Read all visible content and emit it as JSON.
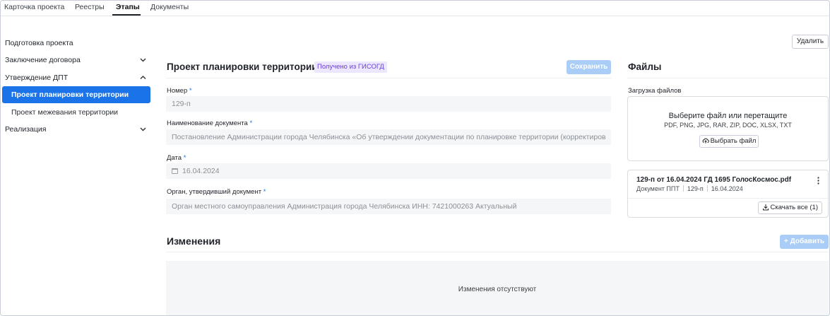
{
  "tabs": [
    {
      "label": "Карточка проекта",
      "active": false
    },
    {
      "label": "Реестры",
      "active": false
    },
    {
      "label": "Этапы",
      "active": true
    },
    {
      "label": "Документы",
      "active": false
    }
  ],
  "sidebar": {
    "items": [
      {
        "label": "Подготовка проекта"
      },
      {
        "label": "Заключение договора",
        "chevron": "chevron-down-icon"
      },
      {
        "label": "Утверждение ДПТ",
        "chevron": "chevron-up-icon"
      },
      {
        "label": "Проект планировки территории",
        "active": true
      },
      {
        "label": "Проект межевания территории"
      },
      {
        "label": "Реализация",
        "chevron": "chevron-down-icon"
      }
    ]
  },
  "form": {
    "title": "Проект планировки территории",
    "badge": "Получено из ГИСОГД",
    "save_label": "Сохранить",
    "fields": {
      "number": {
        "label": "Номер",
        "value": "129-п"
      },
      "doc_name": {
        "label": "Наименование документа",
        "value": "Постановление Администрации города Челябинска «Об утверждении  документации по планировке территории (корректиров"
      },
      "date": {
        "label": "Дата",
        "value": "16.04.2024"
      },
      "authority": {
        "label": "Орган, утвердивший документ",
        "value": "Орган местного самоуправления Администрация города Челябинска ИНН: 7421000263 Актуальный"
      }
    },
    "required_mark": "*"
  },
  "changes": {
    "title": "Изменения",
    "add_label": "Добавить",
    "empty_text": "Изменения отсутствуют"
  },
  "files": {
    "delete_label": "Удалить",
    "title": "Файлы",
    "upload_label": "Загрузка файлов",
    "drop_title": "Выберите файл или перетащите",
    "drop_types": "PDF, PNG, JPG, RAR, ZIP, DOC, XLSX, TXT",
    "choose_label": "Выбрать файл",
    "file": {
      "name": "129-п от 16.04.2024 ГД 1695 ГолосКосмос.pdf",
      "type": "Документ ППТ",
      "number": "129-п",
      "date": "16.04.2024"
    },
    "download_all_label": "Скачать все (1)"
  },
  "colors": {
    "accent": "#1a73e8",
    "disabled_button": "#a9cdf6",
    "badge_text": "#6a3fd8",
    "badge_bg": "#ece6ff",
    "field_bg": "#f5f6f7"
  }
}
